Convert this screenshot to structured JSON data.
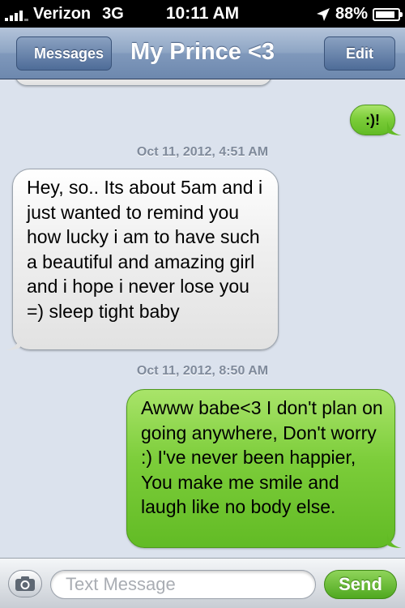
{
  "status_bar": {
    "carrier": "Verizon",
    "network": "3G",
    "time": "10:11 AM",
    "battery": "88%",
    "battery_level": 0.88
  },
  "nav": {
    "back_label": "Messages",
    "title": "My Prince <3",
    "edit_label": "Edit"
  },
  "messages": [
    {
      "type": "outgoing",
      "text": ":)!"
    },
    {
      "type": "timestamp",
      "text": "Oct 11, 2012, 4:51 AM"
    },
    {
      "type": "incoming",
      "text": "Hey, so.. Its about 5am and i just wanted to remind you how lucky i am to have such a beautiful and amazing girl and i hope i never lose you =) sleep tight baby"
    },
    {
      "type": "timestamp",
      "text": "Oct 11, 2012, 8:50 AM"
    },
    {
      "type": "outgoing",
      "text": "Awww babe<3 I don't plan on going anywhere, Don't worry :) I've never been happier, You make me smile and laugh like no body else."
    }
  ],
  "input_bar": {
    "placeholder": "Text Message",
    "send_label": "Send"
  },
  "colors": {
    "outgoing_bubble": "#7ccd3a",
    "incoming_bubble": "#e8e8e8",
    "nav_bar": "#7f98bb",
    "background": "#dbe2ed"
  },
  "icons": {
    "signal": "signal-bars-icon",
    "location": "location-arrow-icon",
    "battery": "battery-icon",
    "camera": "camera-icon"
  }
}
